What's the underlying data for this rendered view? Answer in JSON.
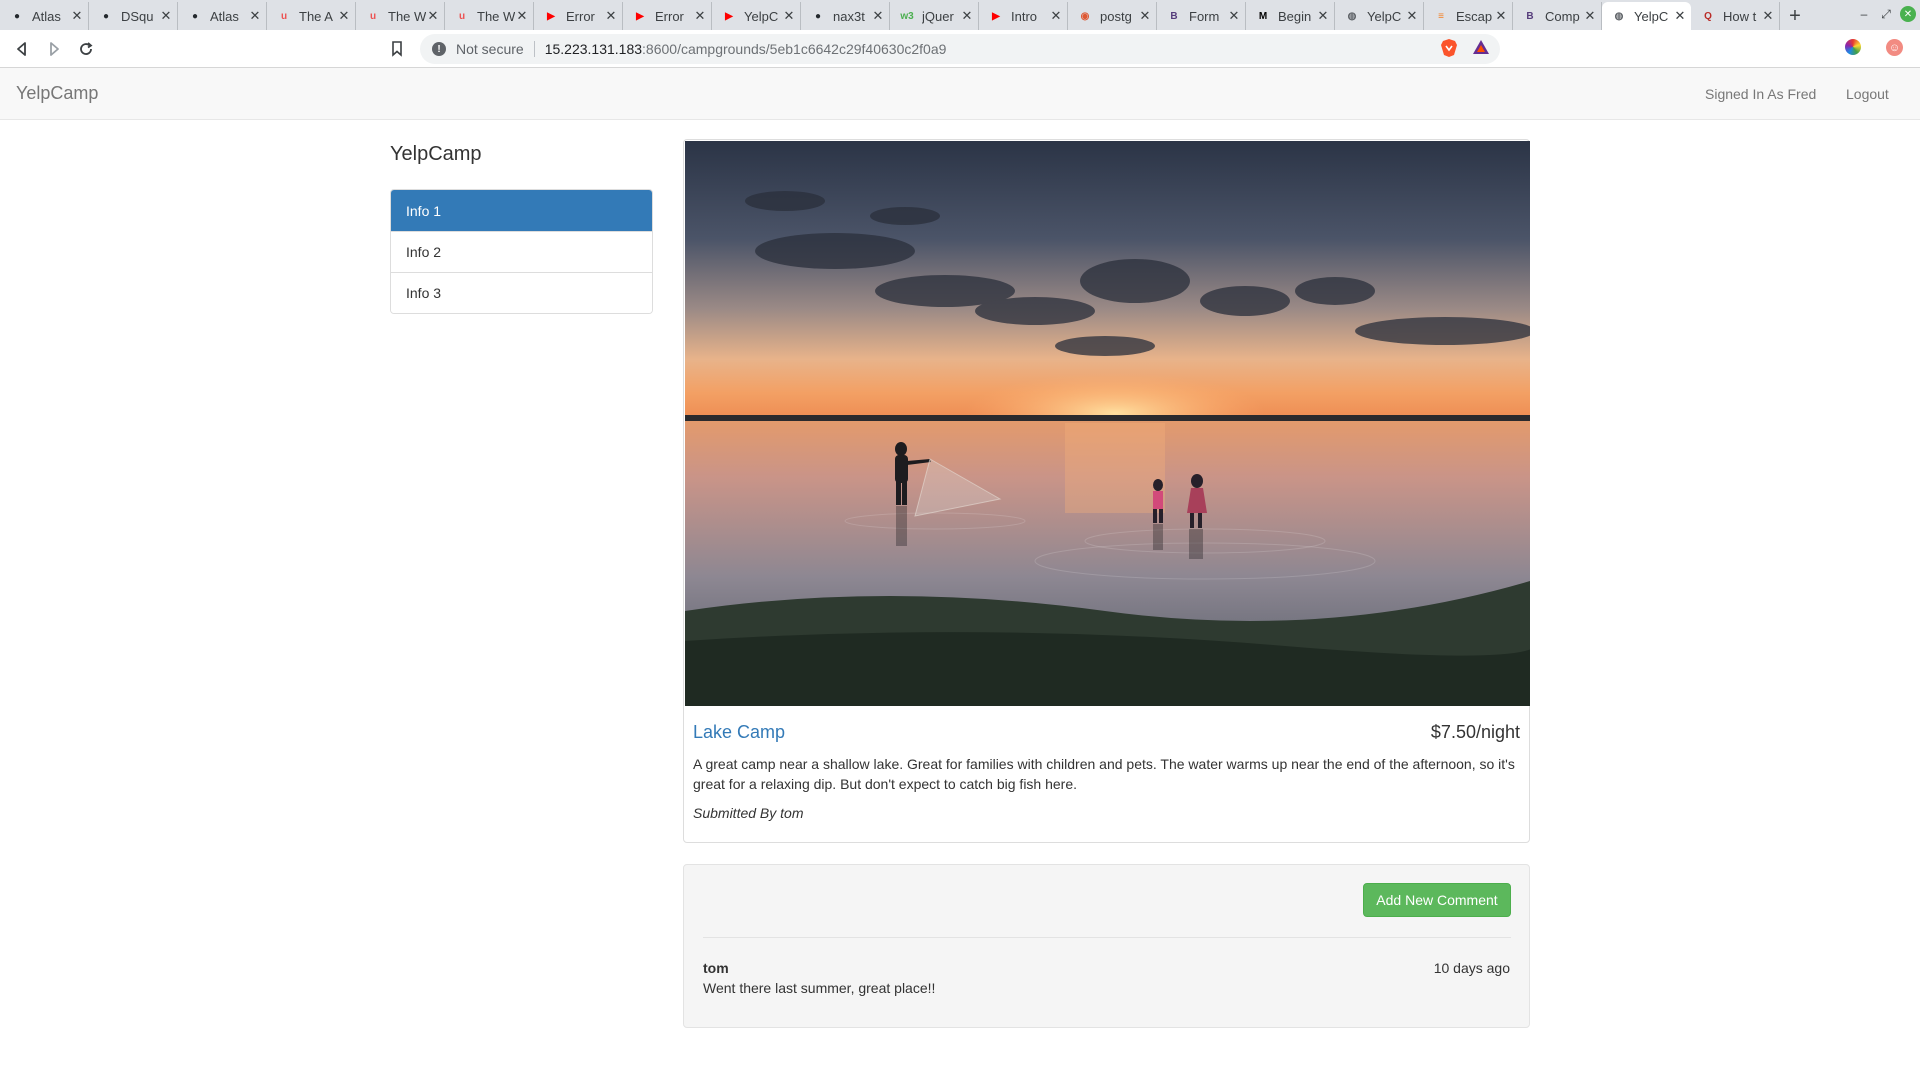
{
  "browser": {
    "tabs": [
      {
        "title": "Atlas",
        "icon": "github-icon",
        "color": "#24292e"
      },
      {
        "title": "DSqu",
        "icon": "github-icon",
        "color": "#24292e"
      },
      {
        "title": "Atlas",
        "icon": "github-icon",
        "color": "#24292e"
      },
      {
        "title": "The A",
        "icon": "udemy-icon",
        "color": "#ec5252"
      },
      {
        "title": "The W",
        "icon": "udemy-icon",
        "color": "#ec5252"
      },
      {
        "title": "The W",
        "icon": "udemy-icon",
        "color": "#ec5252"
      },
      {
        "title": "Error",
        "icon": "youtube-icon",
        "color": "#ff0000"
      },
      {
        "title": "Error",
        "icon": "youtube-icon",
        "color": "#ff0000"
      },
      {
        "title": "YelpC",
        "icon": "youtube-icon",
        "color": "#ff0000"
      },
      {
        "title": "nax3t",
        "icon": "github-icon",
        "color": "#24292e"
      },
      {
        "title": "jQuer",
        "icon": "w3schools-icon",
        "color": "#4caf50"
      },
      {
        "title": "Intro",
        "icon": "youtube-icon",
        "color": "#ff0000"
      },
      {
        "title": "postg",
        "icon": "duckduckgo-icon",
        "color": "#de5833"
      },
      {
        "title": "Form",
        "icon": "bootstrap-icon",
        "color": "#563d7c"
      },
      {
        "title": "Begin",
        "icon": "medium-icon",
        "color": "#000000"
      },
      {
        "title": "YelpC",
        "icon": "globe-icon",
        "color": "#5f6368"
      },
      {
        "title": "Escap",
        "icon": "stackoverflow-icon",
        "color": "#f48024"
      },
      {
        "title": "Comp",
        "icon": "bootstrap-icon",
        "color": "#563d7c"
      },
      {
        "title": "YelpC",
        "icon": "globe-icon",
        "color": "#5f6368",
        "active": true
      },
      {
        "title": "How t",
        "icon": "quora-icon",
        "color": "#b92b27"
      }
    ],
    "address": {
      "security_label": "Not secure",
      "url_host": "15.223.131.183",
      "url_rest": ":8600/campgrounds/5eb1c6642c29f40630c2f0a9"
    }
  },
  "navbar": {
    "brand": "YelpCamp",
    "signed_in": "Signed In As Fred",
    "logout": "Logout"
  },
  "sidebar": {
    "title": "YelpCamp",
    "items": [
      {
        "label": "Info 1",
        "active": true
      },
      {
        "label": "Info 2",
        "active": false
      },
      {
        "label": "Info 3",
        "active": false
      }
    ]
  },
  "campground": {
    "name": "Lake Camp",
    "price": "$7.50/night",
    "description": "A great camp near a shallow lake. Great for families with children and pets. The water warms up near the end of the afternoon, so it's great for a relaxing dip. But don't expect to catch big fish here.",
    "submitted_by": "Submitted By tom"
  },
  "comments": {
    "add_button": "Add New Comment",
    "items": [
      {
        "author": "tom",
        "time": "10 days ago",
        "text": "Went there last summer, great place!!"
      }
    ]
  },
  "colors": {
    "primary": "#337ab7",
    "success": "#5cb85c",
    "navbar_bg": "#f8f8f8",
    "well_bg": "#f5f5f5"
  }
}
